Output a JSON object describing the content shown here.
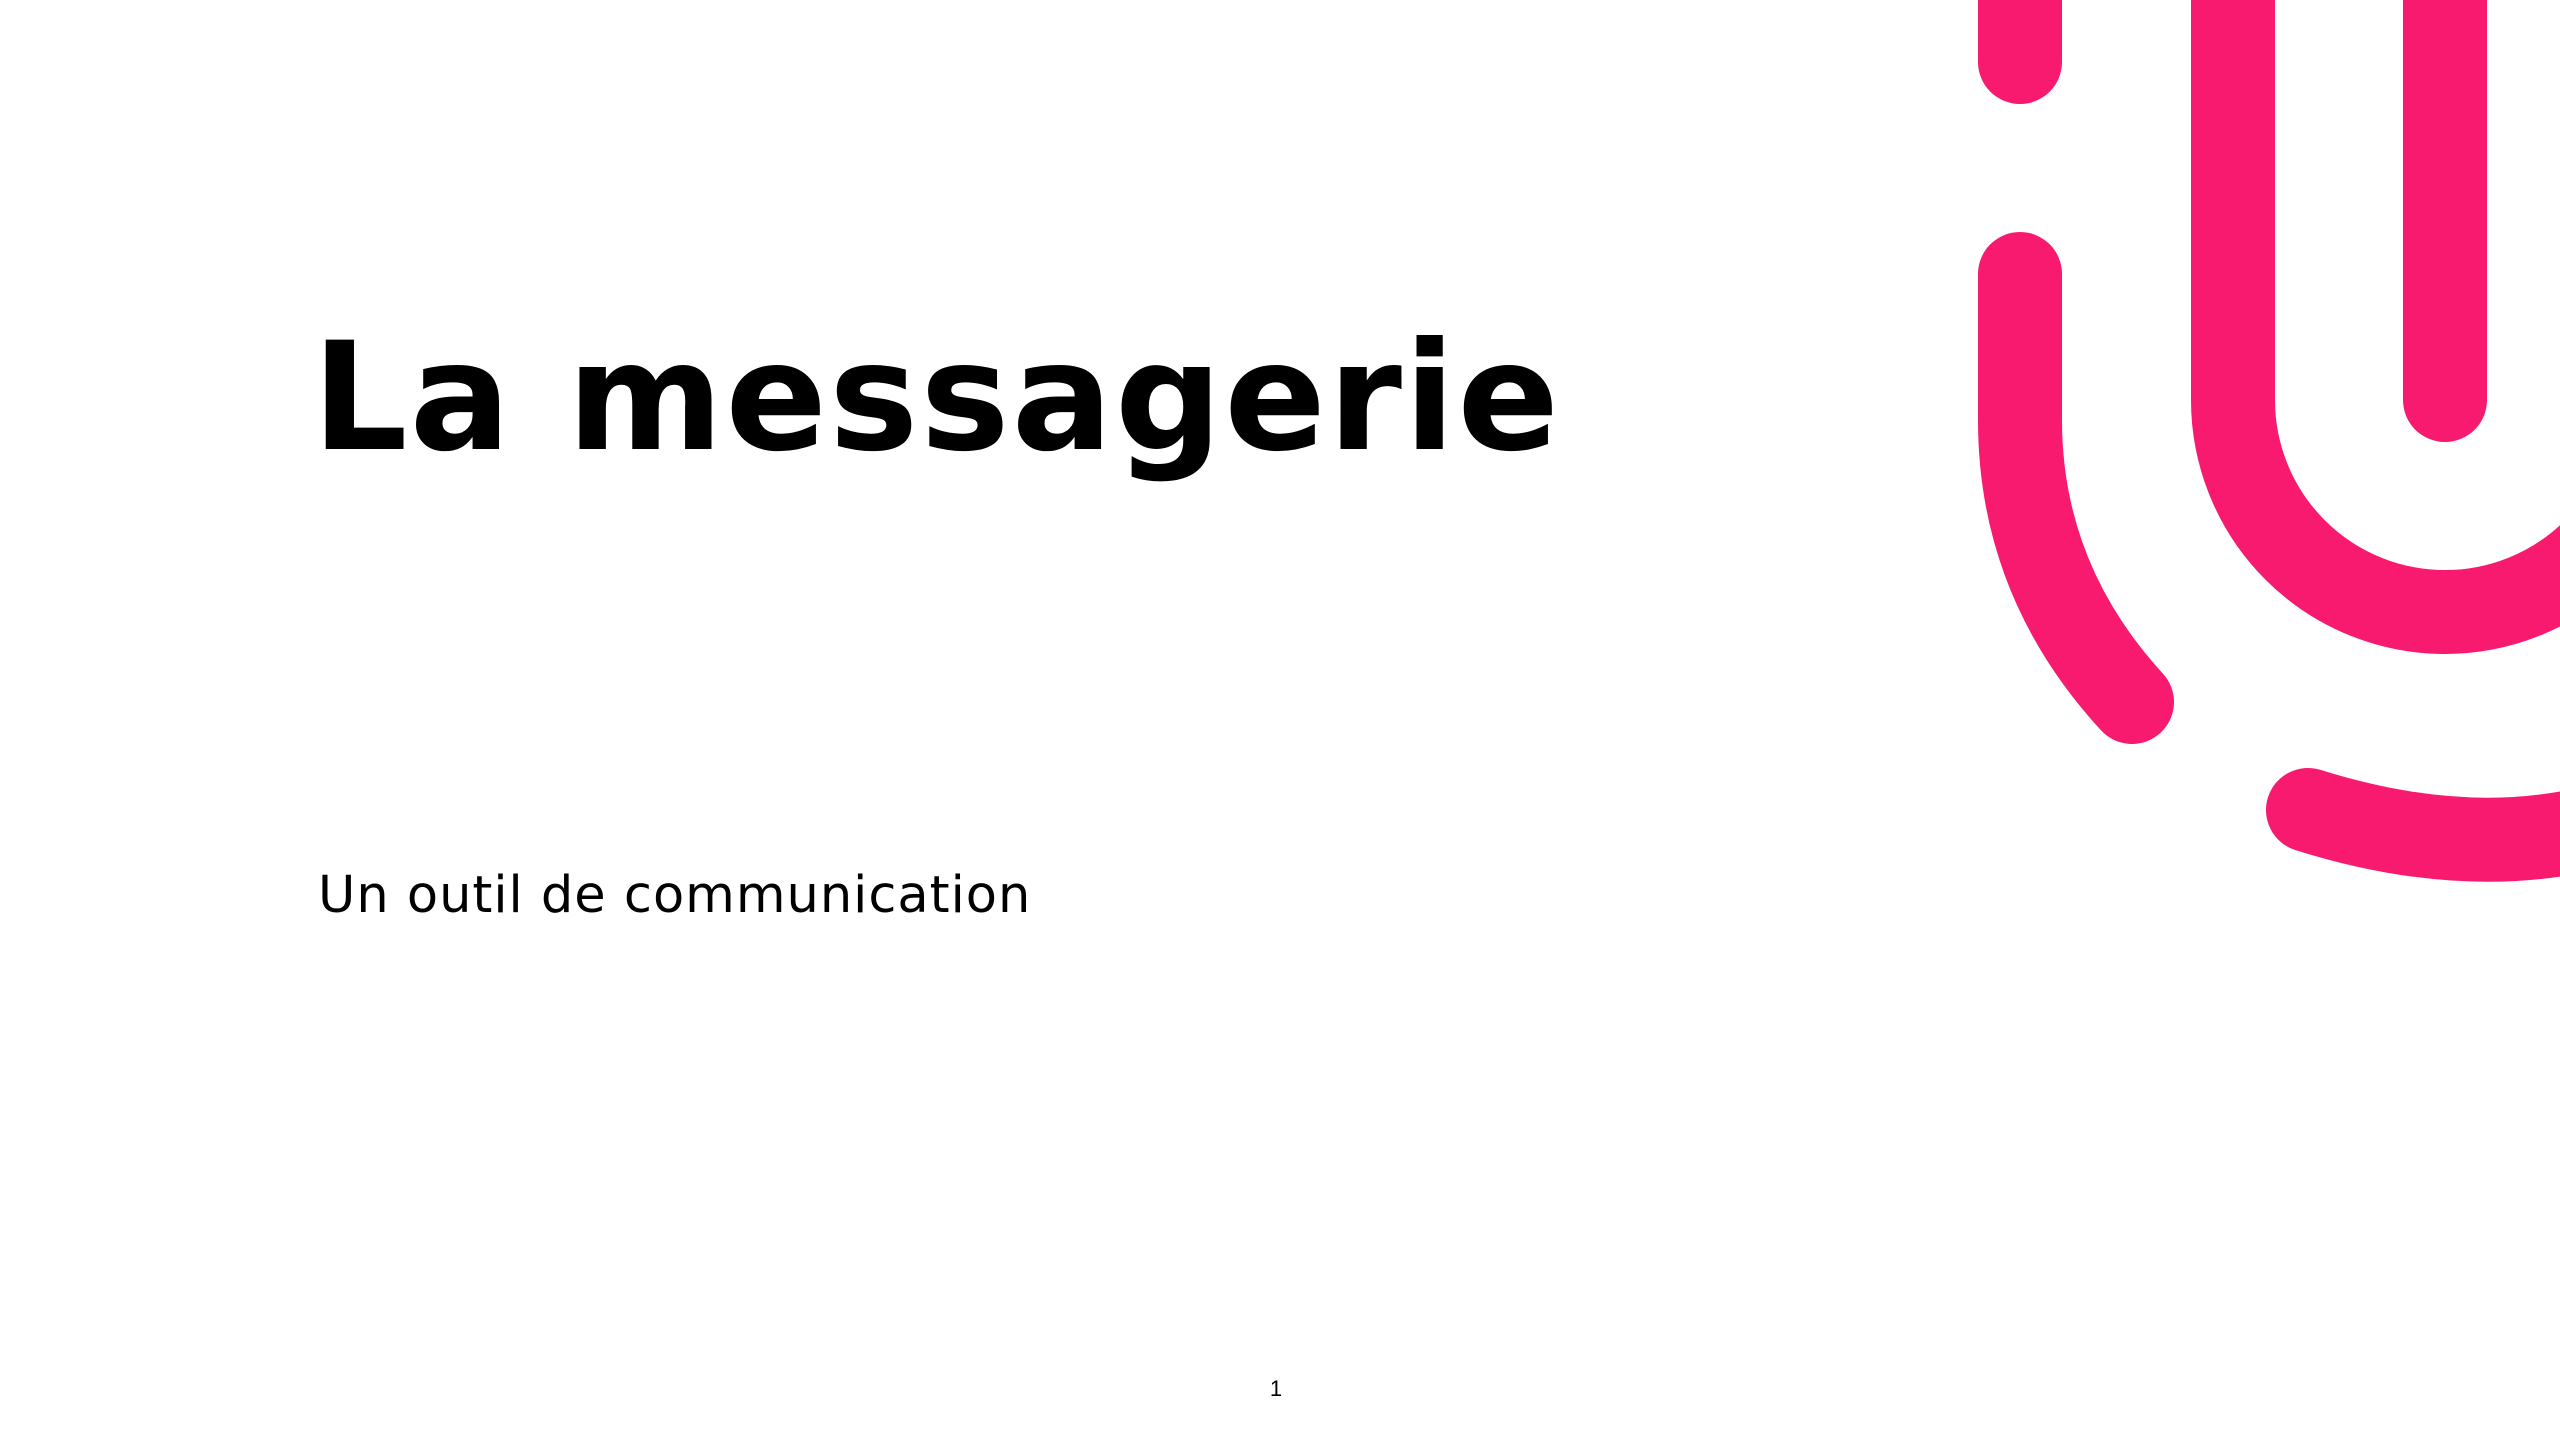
{
  "slide": {
    "title": "La messagerie",
    "subtitle": "Un outil de communication",
    "page_number": "1"
  },
  "decoration": {
    "name": "pink-fingerprint-lines",
    "color": "#F71A6E"
  }
}
